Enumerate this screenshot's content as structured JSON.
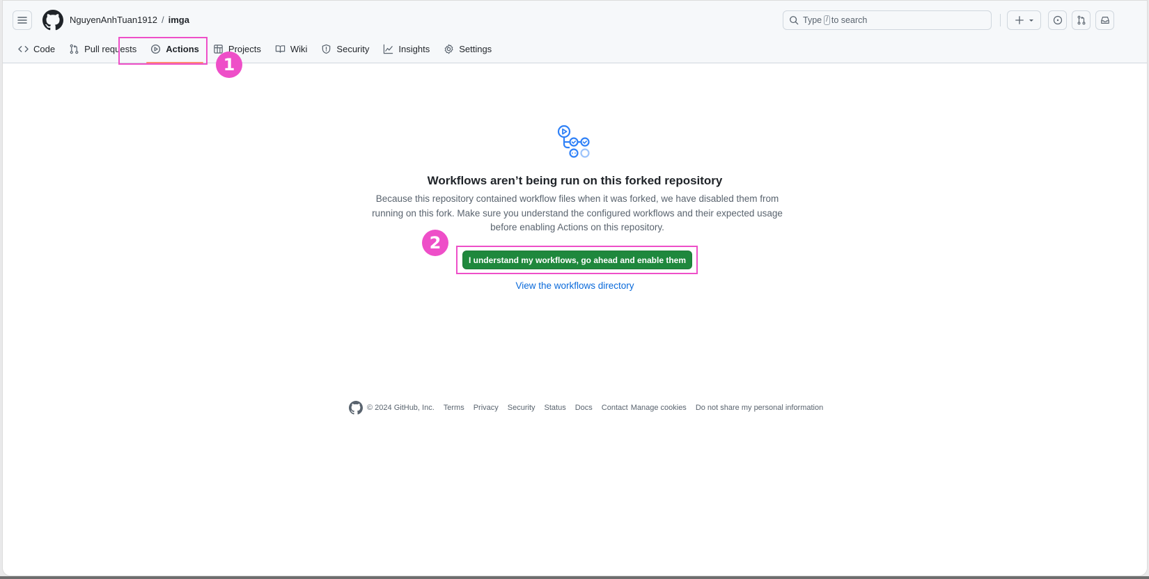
{
  "header": {
    "owner": "NguyenAnhTuan1912",
    "separator": "/",
    "repo": "imga",
    "search": {
      "prefix": "Type",
      "key": "/",
      "suffix": "to search"
    },
    "icons": [
      "menu-icon",
      "github-logo",
      "search-icon",
      "plus-icon",
      "triangle-down-icon",
      "issue-icon",
      "pull-request-icon",
      "inbox-icon"
    ]
  },
  "nav": {
    "tabs": [
      {
        "label": "Code",
        "icon": "code-icon",
        "active": false
      },
      {
        "label": "Pull requests",
        "icon": "pull-request-icon",
        "active": false
      },
      {
        "label": "Actions",
        "icon": "play-icon",
        "active": true
      },
      {
        "label": "Projects",
        "icon": "table-icon",
        "active": false
      },
      {
        "label": "Wiki",
        "icon": "book-icon",
        "active": false
      },
      {
        "label": "Security",
        "icon": "shield-icon",
        "active": false
      },
      {
        "label": "Insights",
        "icon": "graph-icon",
        "active": false
      },
      {
        "label": "Settings",
        "icon": "gear-icon",
        "active": false
      }
    ]
  },
  "annotations": {
    "step1": "1",
    "step2": "2",
    "color": "#ee4fc8"
  },
  "blankslate": {
    "icon": "workflow-icon",
    "title": "Workflows aren’t being run on this forked repository",
    "description": "Because this repository contained workflow files when it was forked, we have disabled them from running on this fork. Make sure you understand the configured workflows and their expected usage before enabling Actions on this repository.",
    "enable_button": "I understand my workflows, go ahead and enable them",
    "directory_link": "View the workflows directory",
    "button_color": "#1f883d",
    "link_color": "#0969da"
  },
  "footer": {
    "copyright": "© 2024 GitHub, Inc.",
    "links": [
      "Terms",
      "Privacy",
      "Security",
      "Status",
      "Docs",
      "Contact",
      "Manage cookies",
      "Do not share my personal information"
    ]
  }
}
